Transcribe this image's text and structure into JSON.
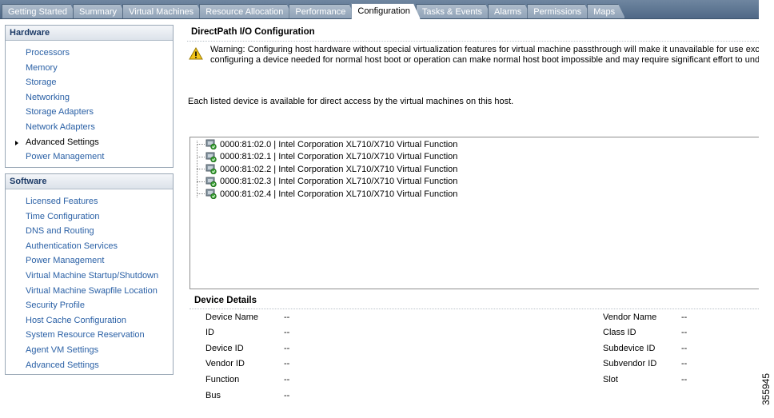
{
  "tabs": [
    {
      "label": "Getting Started"
    },
    {
      "label": "Summary"
    },
    {
      "label": "Virtual Machines"
    },
    {
      "label": "Resource Allocation"
    },
    {
      "label": "Performance"
    },
    {
      "label": "Configuration",
      "active": true
    },
    {
      "label": "Tasks & Events"
    },
    {
      "label": "Alarms"
    },
    {
      "label": "Permissions"
    },
    {
      "label": "Maps"
    }
  ],
  "hardware": {
    "title": "Hardware",
    "items": [
      {
        "label": "Processors"
      },
      {
        "label": "Memory"
      },
      {
        "label": "Storage"
      },
      {
        "label": "Networking"
      },
      {
        "label": "Storage Adapters"
      },
      {
        "label": "Network Adapters"
      },
      {
        "label": "Advanced Settings",
        "current": true
      },
      {
        "label": "Power Management"
      }
    ]
  },
  "software": {
    "title": "Software",
    "items": [
      {
        "label": "Licensed Features"
      },
      {
        "label": "Time Configuration"
      },
      {
        "label": "DNS and Routing"
      },
      {
        "label": "Authentication Services"
      },
      {
        "label": "Power Management"
      },
      {
        "label": "Virtual Machine Startup/Shutdown"
      },
      {
        "label": "Virtual Machine Swapfile Location"
      },
      {
        "label": "Security Profile"
      },
      {
        "label": "Host Cache Configuration"
      },
      {
        "label": "System Resource Reservation"
      },
      {
        "label": "Agent VM Settings"
      },
      {
        "label": "Advanced Settings"
      }
    ]
  },
  "main": {
    "title": "DirectPath I/O Configuration",
    "warning_line1": "Warning: Configuring host hardware without special virtualization features for virtual machine passthrough will make it unavailable for use except w",
    "warning_line2": "configuring a device needed for normal host boot or operation can make normal host boot impossible and may require significant effort to undo. Se",
    "available_text": "Each listed device is available for direct access by the virtual machines on this host.",
    "devices": [
      {
        "label": "0000:81:02.0 | Intel Corporation XL710/X710 Virtual Function"
      },
      {
        "label": "0000:81:02.1 | Intel Corporation XL710/X710 Virtual Function"
      },
      {
        "label": "0000:81:02.2 | Intel Corporation XL710/X710 Virtual Function"
      },
      {
        "label": "0000:81:02.3 | Intel Corporation XL710/X710 Virtual Function"
      },
      {
        "label": "0000:81:02.4 | Intel Corporation XL710/X710 Virtual Function"
      }
    ],
    "device_details": {
      "title": "Device Details",
      "left": [
        {
          "label": "Device Name",
          "value": "--"
        },
        {
          "label": "ID",
          "value": "--"
        },
        {
          "label": "Device ID",
          "value": "--"
        },
        {
          "label": "Vendor ID",
          "value": "--"
        },
        {
          "label": "Function",
          "value": "--"
        },
        {
          "label": "Bus",
          "value": "--"
        }
      ],
      "right": [
        {
          "label": "Vendor Name",
          "value": "--"
        },
        {
          "label": "Class ID",
          "value": "--"
        },
        {
          "label": "Subdevice ID",
          "value": "--"
        },
        {
          "label": "Subvendor ID",
          "value": "--"
        },
        {
          "label": "Slot",
          "value": "--"
        }
      ]
    }
  },
  "figure_number": "355945",
  "colors": {
    "link": "#2b61a6",
    "tabbar": "#5a7391",
    "panel_title": "#1c3a66"
  }
}
